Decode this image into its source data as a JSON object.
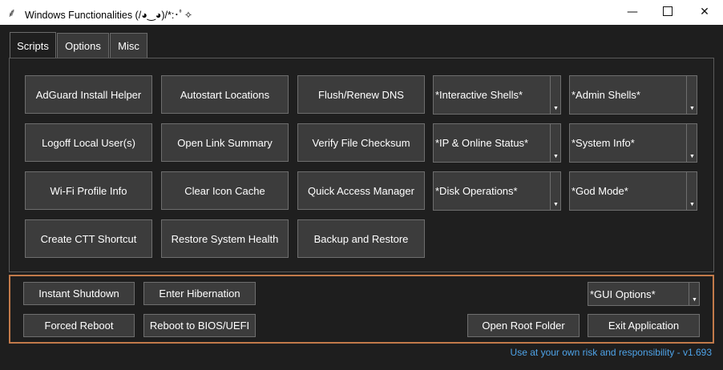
{
  "window": {
    "title": "Windows Functionalities (/◕‿◕)/*:･ﾟ✧",
    "app_icon": "feather-icon",
    "min_glyph": "—",
    "close_glyph": "✕"
  },
  "tabs": [
    {
      "label": "Scripts",
      "active": true
    },
    {
      "label": "Options",
      "active": false
    },
    {
      "label": "Misc",
      "active": false
    }
  ],
  "scripts": {
    "col1": [
      "AdGuard Install Helper",
      "Logoff Local User(s)",
      "Wi-Fi Profile Info",
      "Create CTT Shortcut"
    ],
    "col2": [
      "Autostart Locations",
      "Open Link Summary",
      "Clear Icon Cache",
      "Restore System Health"
    ],
    "col3": [
      "Flush/Renew DNS",
      "Verify File Checksum",
      "Quick Access Manager",
      "Backup and Restore"
    ],
    "dropdowns_col4": [
      "*Interactive Shells*",
      "*IP & Online Status*",
      "*Disk Operations*"
    ],
    "dropdowns_col5": [
      "*Admin Shells*",
      "*System Info*",
      "*God Mode*"
    ],
    "dropdown_arrow": "▼"
  },
  "bottom": {
    "instant_shutdown": "Instant Shutdown",
    "enter_hibernation": "Enter Hibernation",
    "forced_reboot": "Forced Reboot",
    "reboot_bios": "Reboot to BIOS/UEFI",
    "gui_options": "*GUI Options*",
    "open_root_folder": "Open Root Folder",
    "exit_application": "Exit Application"
  },
  "footer": "Use at your own risk and responsibility - v1.693",
  "colors": {
    "background": "#1e1e1e",
    "button": "#3c3c3c",
    "frame_accent": "#c27a4a",
    "footer_link": "#4ea3e8"
  }
}
